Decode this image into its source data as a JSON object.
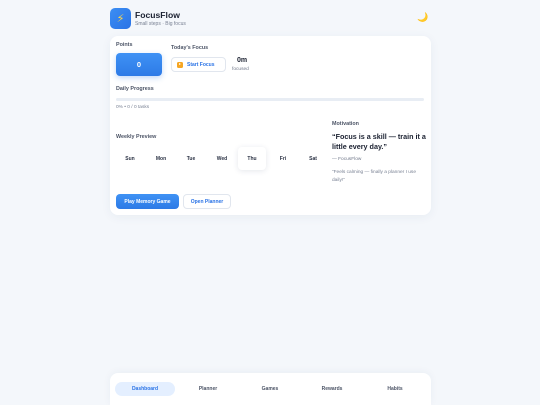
{
  "app": {
    "title": "FocusFlow",
    "subtitle": "Small steps · Big focus",
    "logo_icon": "lightning-bolt-icon",
    "theme_icon": "moon-icon"
  },
  "points": {
    "label": "Points",
    "value": "0"
  },
  "focus": {
    "label": "Today's Focus",
    "start_button": "Start Focus",
    "value": "0m",
    "value_label": "focused"
  },
  "progress": {
    "label": "Daily Progress",
    "fraction": 0,
    "text": "0% • 0 / 0 tasks"
  },
  "weekly": {
    "label": "Weekly Preview",
    "days": [
      "Sun",
      "Mon",
      "Tue",
      "Wed",
      "Thu",
      "Fri",
      "Sat"
    ],
    "today_index": 4
  },
  "motivation": {
    "label": "Motivation",
    "quote": "“Focus is a skill — train it a little every day.”",
    "author": "— FocusFlow",
    "testimonial": "“Feels calming — finally a planner I use daily!”"
  },
  "actions": {
    "primary": "Play Memory Game",
    "secondary": "Open Planner"
  },
  "nav": {
    "items": [
      "Dashboard",
      "Planner",
      "Games",
      "Rewards",
      "Habits"
    ],
    "active_index": 0
  },
  "colors": {
    "accent": "#2d7ae6",
    "background": "#f4f7fb",
    "focus_icon": "#f6a623"
  }
}
